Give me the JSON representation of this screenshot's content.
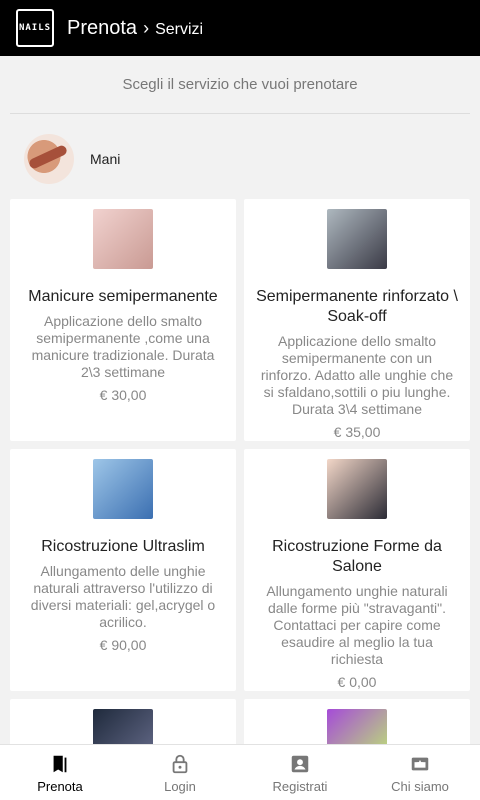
{
  "header": {
    "logo_text": "NAILS",
    "title": "Prenota",
    "separator": "›",
    "subtitle": "Servizi"
  },
  "page": {
    "instruction": "Scegli il servizio che vuoi prenotare"
  },
  "category": {
    "label": "Mani"
  },
  "services": [
    {
      "title": "Manicure semipermanente",
      "description": "Applicazione dello smalto semipermanente ,come una manicure tradizionale. Durata 2\\3 settimane",
      "price": "€ 30,00"
    },
    {
      "title": "Semipermanente rinforzato \\ Soak-off",
      "description": "Applicazione dello smalto semipermanente con un rinforzo. Adatto alle unghie che si sfaldano,sottili o piu lunghe. Durata 3\\4 settimane",
      "price": "€ 35,00"
    },
    {
      "title": "Ricostruzione Ultraslim",
      "description": "Allungamento delle unghie naturali attraverso l'utilizzo di diversi materiali: gel,acrygel o acrilico.",
      "price": "€ 90,00"
    },
    {
      "title": "Ricostruzione Forme da Salone",
      "description": "Allungamento unghie naturali dalle forme più \"stravaganti\". Contattaci per capire come esaudire al meglio la tua richiesta",
      "price": "€ 0,00"
    }
  ],
  "tabbar": {
    "items": [
      {
        "label": "Prenota",
        "icon": "bookmark-icon",
        "active": true
      },
      {
        "label": "Login",
        "icon": "lock-icon",
        "active": false
      },
      {
        "label": "Registrati",
        "icon": "account-box-icon",
        "active": false
      },
      {
        "label": "Chi siamo",
        "icon": "storefront-icon",
        "active": false
      }
    ]
  },
  "colors": {
    "appbar": "#000000",
    "background": "#f2f2f2",
    "card": "#ffffff",
    "muted_text": "#888888"
  }
}
